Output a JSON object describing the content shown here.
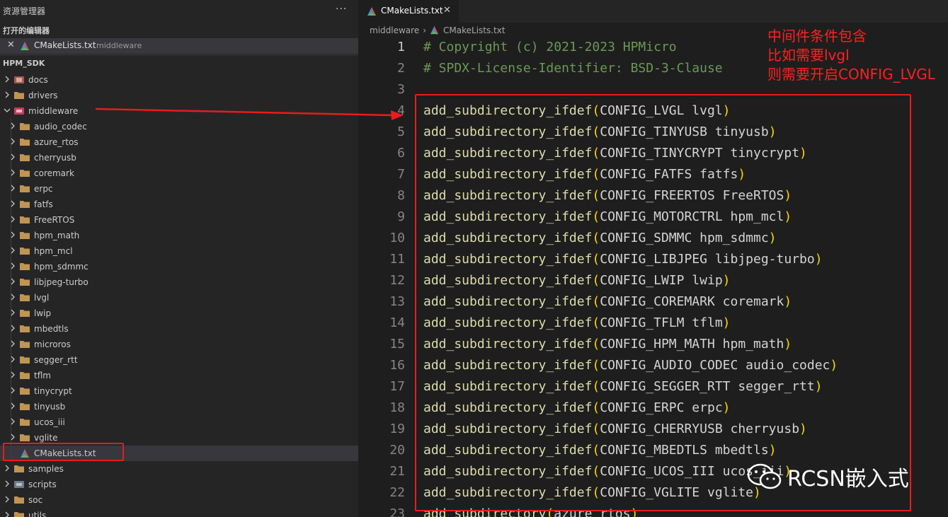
{
  "sidebar": {
    "title": "资源管理器",
    "more": "···",
    "open_editors": {
      "header": "打开的编辑器",
      "item": {
        "close": "✕",
        "name": "CMakeLists.txt",
        "dir": "middleware"
      }
    },
    "workspace": "HPM_SDK",
    "tree": [
      {
        "label": "docs",
        "depth": 0,
        "chevron": "right",
        "icon": "docs-folder"
      },
      {
        "label": "drivers",
        "depth": 0,
        "chevron": "right",
        "icon": "folder"
      },
      {
        "label": "middleware",
        "depth": 0,
        "chevron": "down",
        "icon": "middleware-folder"
      },
      {
        "label": "audio_codec",
        "depth": 1,
        "chevron": "right",
        "icon": "folder"
      },
      {
        "label": "azure_rtos",
        "depth": 1,
        "chevron": "right",
        "icon": "folder"
      },
      {
        "label": "cherryusb",
        "depth": 1,
        "chevron": "right",
        "icon": "folder"
      },
      {
        "label": "coremark",
        "depth": 1,
        "chevron": "right",
        "icon": "folder"
      },
      {
        "label": "erpc",
        "depth": 1,
        "chevron": "right",
        "icon": "folder"
      },
      {
        "label": "fatfs",
        "depth": 1,
        "chevron": "right",
        "icon": "folder"
      },
      {
        "label": "FreeRTOS",
        "depth": 1,
        "chevron": "right",
        "icon": "folder"
      },
      {
        "label": "hpm_math",
        "depth": 1,
        "chevron": "right",
        "icon": "folder"
      },
      {
        "label": "hpm_mcl",
        "depth": 1,
        "chevron": "right",
        "icon": "folder"
      },
      {
        "label": "hpm_sdmmc",
        "depth": 1,
        "chevron": "right",
        "icon": "folder"
      },
      {
        "label": "libjpeg-turbo",
        "depth": 1,
        "chevron": "right",
        "icon": "folder"
      },
      {
        "label": "lvgl",
        "depth": 1,
        "chevron": "right",
        "icon": "folder"
      },
      {
        "label": "lwip",
        "depth": 1,
        "chevron": "right",
        "icon": "folder"
      },
      {
        "label": "mbedtls",
        "depth": 1,
        "chevron": "right",
        "icon": "folder"
      },
      {
        "label": "microros",
        "depth": 1,
        "chevron": "right",
        "icon": "folder"
      },
      {
        "label": "segger_rtt",
        "depth": 1,
        "chevron": "right",
        "icon": "folder"
      },
      {
        "label": "tflm",
        "depth": 1,
        "chevron": "right",
        "icon": "folder"
      },
      {
        "label": "tinycrypt",
        "depth": 1,
        "chevron": "right",
        "icon": "folder"
      },
      {
        "label": "tinyusb",
        "depth": 1,
        "chevron": "right",
        "icon": "folder"
      },
      {
        "label": "ucos_iii",
        "depth": 1,
        "chevron": "right",
        "icon": "folder"
      },
      {
        "label": "vglite",
        "depth": 1,
        "chevron": "right",
        "icon": "folder"
      },
      {
        "label": "CMakeLists.txt",
        "depth": 1,
        "chevron": "none",
        "icon": "cmake",
        "selected": true
      },
      {
        "label": "samples",
        "depth": 0,
        "chevron": "right",
        "icon": "folder"
      },
      {
        "label": "scripts",
        "depth": 0,
        "chevron": "right",
        "icon": "scripts-folder"
      },
      {
        "label": "soc",
        "depth": 0,
        "chevron": "right",
        "icon": "folder"
      },
      {
        "label": "utils",
        "depth": 0,
        "chevron": "right",
        "icon": "folder"
      }
    ]
  },
  "editor": {
    "tab": {
      "name": "CMakeLists.txt",
      "close": "✕"
    },
    "breadcrumb": {
      "dir": "middleware",
      "sep": "›",
      "file": "CMakeLists.txt"
    },
    "lines": [
      {
        "num": "1",
        "kind": "comment",
        "text": "# Copyright (c) 2021-2023 HPMicro"
      },
      {
        "num": "2",
        "kind": "comment",
        "text": "# SPDX-License-Identifier: BSD-3-Clause"
      },
      {
        "num": "3",
        "kind": "empty",
        "text": ""
      },
      {
        "num": "4",
        "kind": "call",
        "fn": "add_subdirectory_ifdef",
        "args": "CONFIG_LVGL lvgl"
      },
      {
        "num": "5",
        "kind": "call",
        "fn": "add_subdirectory_ifdef",
        "args": "CONFIG_TINYUSB tinyusb"
      },
      {
        "num": "6",
        "kind": "call",
        "fn": "add_subdirectory_ifdef",
        "args": "CONFIG_TINYCRYPT tinycrypt"
      },
      {
        "num": "7",
        "kind": "call",
        "fn": "add_subdirectory_ifdef",
        "args": "CONFIG_FATFS fatfs"
      },
      {
        "num": "8",
        "kind": "call",
        "fn": "add_subdirectory_ifdef",
        "args": "CONFIG_FREERTOS FreeRTOS"
      },
      {
        "num": "9",
        "kind": "call",
        "fn": "add_subdirectory_ifdef",
        "args": "CONFIG_MOTORCTRL hpm_mcl"
      },
      {
        "num": "10",
        "kind": "call",
        "fn": "add_subdirectory_ifdef",
        "args": "CONFIG_SDMMC hpm_sdmmc"
      },
      {
        "num": "11",
        "kind": "call",
        "fn": "add_subdirectory_ifdef",
        "args": "CONFIG_LIBJPEG libjpeg-turbo"
      },
      {
        "num": "12",
        "kind": "call",
        "fn": "add_subdirectory_ifdef",
        "args": "CONFIG_LWIP lwip"
      },
      {
        "num": "13",
        "kind": "call",
        "fn": "add_subdirectory_ifdef",
        "args": "CONFIG_COREMARK coremark"
      },
      {
        "num": "14",
        "kind": "call",
        "fn": "add_subdirectory_ifdef",
        "args": "CONFIG_TFLM tflm"
      },
      {
        "num": "15",
        "kind": "call",
        "fn": "add_subdirectory_ifdef",
        "args": "CONFIG_HPM_MATH hpm_math"
      },
      {
        "num": "16",
        "kind": "call",
        "fn": "add_subdirectory_ifdef",
        "args": "CONFIG_AUDIO_CODEC audio_codec"
      },
      {
        "num": "17",
        "kind": "call",
        "fn": "add_subdirectory_ifdef",
        "args": "CONFIG_SEGGER_RTT segger_rtt"
      },
      {
        "num": "18",
        "kind": "call",
        "fn": "add_subdirectory_ifdef",
        "args": "CONFIG_ERPC erpc"
      },
      {
        "num": "19",
        "kind": "call",
        "fn": "add_subdirectory_ifdef",
        "args": "CONFIG_CHERRYUSB cherryusb"
      },
      {
        "num": "20",
        "kind": "call",
        "fn": "add_subdirectory_ifdef",
        "args": "CONFIG_MBEDTLS mbedtls"
      },
      {
        "num": "21",
        "kind": "call",
        "fn": "add_subdirectory_ifdef",
        "args": "CONFIG_UCOS_III ucos_iii"
      },
      {
        "num": "22",
        "kind": "call",
        "fn": "add_subdirectory_ifdef",
        "args": "CONFIG_VGLITE vglite"
      },
      {
        "num": "23",
        "kind": "call",
        "fn": "add_subdirectory",
        "args": "azure_rtos"
      }
    ]
  },
  "annotation": {
    "lines": [
      "中间件条件包含",
      "比如需要lvgl",
      "则需要开启CONFIG_LVGL"
    ],
    "color": "#ff2020"
  },
  "watermark": {
    "text": "RCSN嵌入式"
  },
  "colors": {
    "function": "#dcdcaa",
    "paren": "#ffd700",
    "comment": "#6a9955",
    "highlight_box": "#e81c1c",
    "folder": "#c09553"
  }
}
